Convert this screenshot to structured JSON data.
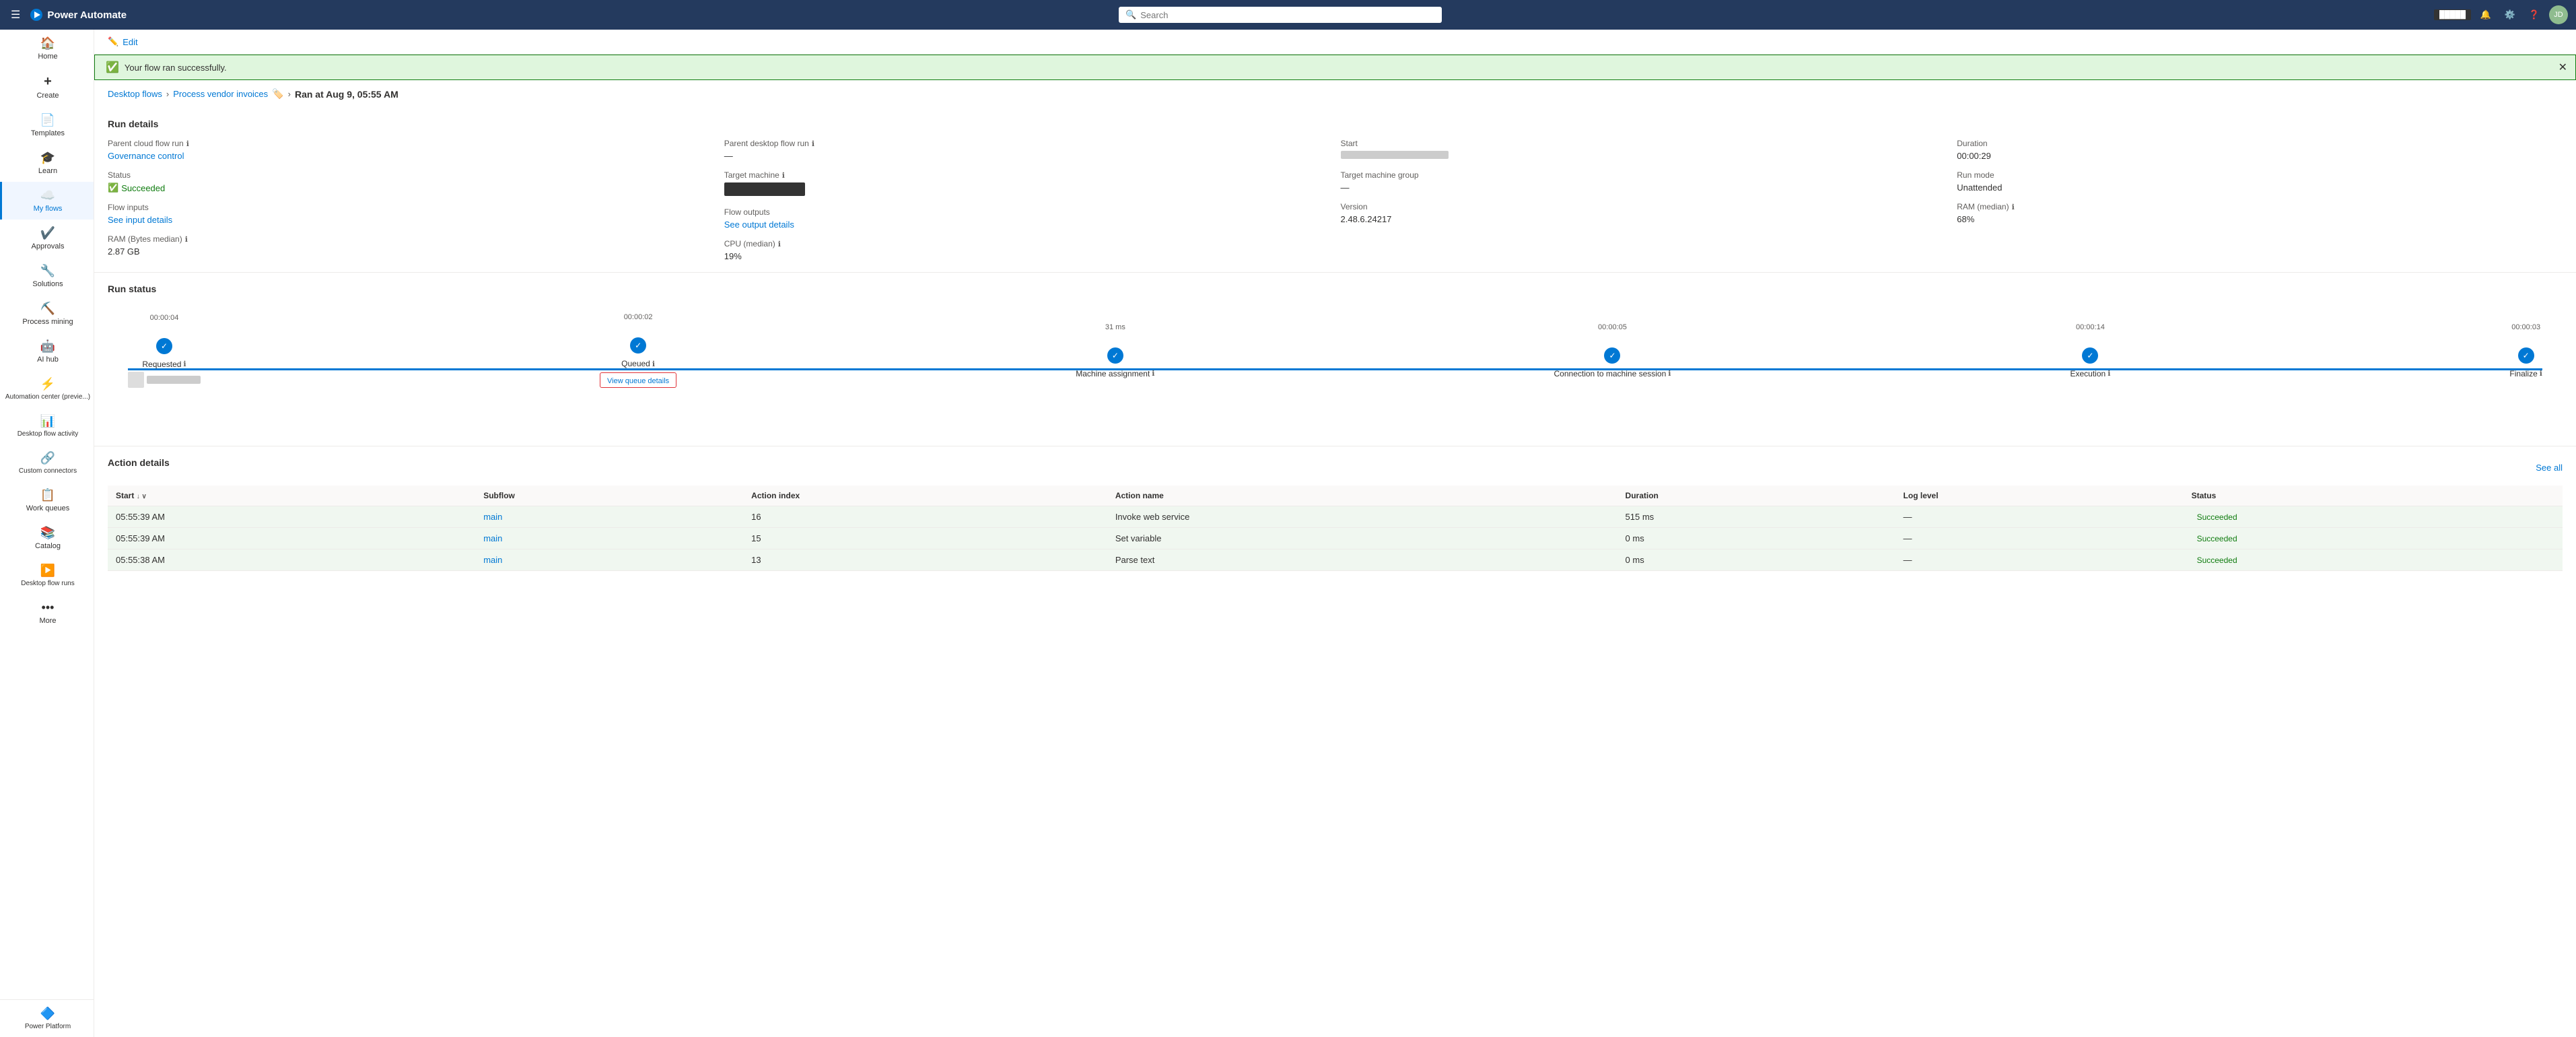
{
  "app": {
    "name": "Power Automate",
    "topbar_bg": "#243a5e"
  },
  "search": {
    "placeholder": "Search"
  },
  "sidebar": {
    "items": [
      {
        "id": "home",
        "label": "Home",
        "icon": "🏠"
      },
      {
        "id": "create",
        "label": "Create",
        "icon": "+"
      },
      {
        "id": "templates",
        "label": "Templates",
        "icon": "📄"
      },
      {
        "id": "learn",
        "label": "Learn",
        "icon": "🎓"
      },
      {
        "id": "my-flows",
        "label": "My flows",
        "icon": "☁️",
        "active": true
      },
      {
        "id": "approvals",
        "label": "Approvals",
        "icon": "✔️"
      },
      {
        "id": "solutions",
        "label": "Solutions",
        "icon": "🔧"
      },
      {
        "id": "process-mining",
        "label": "Process mining",
        "icon": "⛏️"
      },
      {
        "id": "ai-hub",
        "label": "AI hub",
        "icon": "🤖"
      },
      {
        "id": "automation-center",
        "label": "Automation center (previe...)",
        "icon": "⚡"
      },
      {
        "id": "desktop-flow-activity",
        "label": "Desktop flow activity",
        "icon": "📊"
      },
      {
        "id": "custom-connectors",
        "label": "Custom connectors",
        "icon": "🔗"
      },
      {
        "id": "work-queues",
        "label": "Work queues",
        "icon": "📋"
      },
      {
        "id": "catalog",
        "label": "Catalog",
        "icon": "📚"
      },
      {
        "id": "desktop-flow-runs",
        "label": "Desktop flow runs",
        "icon": "▶️"
      },
      {
        "id": "more",
        "label": "More",
        "icon": "···"
      }
    ],
    "bottom": {
      "id": "power-platform",
      "label": "Power Platform",
      "icon": "🔷"
    }
  },
  "edit": {
    "label": "Edit"
  },
  "banner": {
    "message": "Your flow ran successfully.",
    "color": "#107c10"
  },
  "breadcrumb": {
    "parent": "Desktop flows",
    "flow_name": "Process vendor invoices",
    "run_time": "Ran at Aug 9, 05:55 AM"
  },
  "run_details": {
    "title": "Run details",
    "parent_cloud_flow_run": {
      "label": "Parent cloud flow run",
      "value": "Governance control",
      "link": true
    },
    "parent_desktop_flow_run": {
      "label": "Parent desktop flow run",
      "value": "—"
    },
    "start": {
      "label": "Start",
      "value": ""
    },
    "duration": {
      "label": "Duration",
      "value": "00:00:29"
    },
    "status": {
      "label": "Status",
      "value": "Succeeded"
    },
    "target_machine": {
      "label": "Target machine",
      "value": ""
    },
    "target_machine_group": {
      "label": "Target machine group",
      "value": "—"
    },
    "run_mode": {
      "label": "Run mode",
      "value": "Unattended"
    },
    "flow_inputs": {
      "label": "Flow inputs",
      "value": "See input details",
      "link": true
    },
    "flow_outputs": {
      "label": "Flow outputs",
      "value": "See output details",
      "link": true
    },
    "version": {
      "label": "Version",
      "value": "2.48.6.24217"
    },
    "ram_median": {
      "label": "RAM (median)",
      "value": "68%"
    },
    "ram_bytes_median": {
      "label": "RAM (Bytes median)",
      "value": "2.87 GB"
    },
    "cpu_median": {
      "label": "CPU (median)",
      "value": "19%"
    }
  },
  "run_status": {
    "title": "Run status",
    "steps": [
      {
        "id": "requested",
        "label": "Requested",
        "time": "00:00:04",
        "has_info": true,
        "has_sub": true
      },
      {
        "id": "queued",
        "label": "Queued",
        "time": "00:00:02",
        "has_info": true,
        "has_queue_link": true,
        "queue_label": "View queue details"
      },
      {
        "id": "machine-assignment",
        "label": "Machine assignment",
        "time": "31 ms",
        "has_info": true
      },
      {
        "id": "connection-to-machine-session",
        "label": "Connection to machine session",
        "time": "00:00:05",
        "has_info": true
      },
      {
        "id": "execution",
        "label": "Execution",
        "time": "00:00:14",
        "has_info": true
      },
      {
        "id": "finalize",
        "label": "Finalize",
        "time": "00:00:03",
        "has_info": true
      }
    ]
  },
  "action_details": {
    "title": "Action details",
    "see_all_label": "See all",
    "columns": [
      "Start",
      "Subflow",
      "Action index",
      "Action name",
      "Duration",
      "Log level",
      "Status"
    ],
    "rows": [
      {
        "start": "05:55:39 AM",
        "subflow": "main",
        "action_index": "16",
        "action_name": "Invoke web service",
        "duration": "515 ms",
        "log_level": "—",
        "status": "Succeeded"
      },
      {
        "start": "05:55:39 AM",
        "subflow": "main",
        "action_index": "15",
        "action_name": "Set variable",
        "duration": "0 ms",
        "log_level": "—",
        "status": "Succeeded"
      },
      {
        "start": "05:55:38 AM",
        "subflow": "main",
        "action_index": "13",
        "action_name": "Parse text",
        "duration": "0 ms",
        "log_level": "—",
        "status": "Succeeded"
      }
    ]
  }
}
